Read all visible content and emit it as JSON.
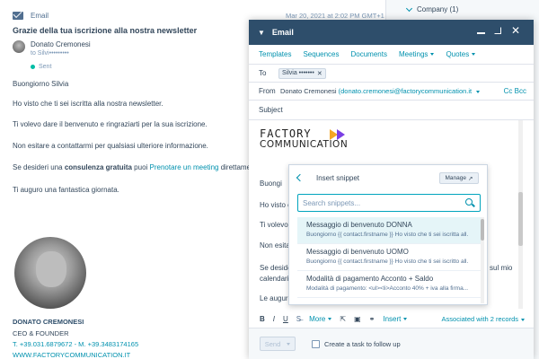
{
  "background_email": {
    "header_label": "Email",
    "date": "Mar 20, 2021 at 2:02 PM GMT+1",
    "subject": "Grazie della tua iscrizione alla nostra newsletter",
    "sender_name": "Donato Cremonesi",
    "sender_to": "to Silvi•••••••••",
    "status": "Sent",
    "greeting": "Buongiorno Silvia",
    "lines": [
      "Ho visto che ti sei iscritta alla nostra newsletter.",
      "Ti volevo dare il benvenuto e ringraziarti per la sua iscrizione.",
      "Non esitare a contattarmi per qualsiasi ulteriore informazione."
    ],
    "consult_prefix": "Se desideri una ",
    "consult_bold": "consulenza gratuita",
    "consult_mid": " puoi ",
    "consult_link": "Prenotare un meeting",
    "consult_suffix": " direttamente sul",
    "closing": "Ti auguro una fantastica giornata.",
    "signature": {
      "name": "DONATO CREMONESI",
      "role": "CEO & FOUNDER",
      "phones": "T. +39.031.6879672 - M. +39.3483174165",
      "website": "WWW.FACTORYCOMMUNICATION.IT"
    }
  },
  "sidebar": {
    "company_label": "Company (1)"
  },
  "compose": {
    "title": "Email",
    "tabs": [
      {
        "label": "Templates"
      },
      {
        "label": "Sequences"
      },
      {
        "label": "Documents"
      },
      {
        "label": "Meetings"
      },
      {
        "label": "Quotes"
      }
    ],
    "to_label": "To",
    "to_chip": "Silvia •••••••",
    "from_label": "From",
    "from_name": "Donato Cremonesi",
    "from_email": "(donato.cremonesi@factorycommunication.it",
    "cc_label": "Cc Bcc",
    "subject_label": "Subject",
    "logo_line1": "FACTORY",
    "logo_line2": "COMMUNICATION",
    "body_lines": [
      "Buongi",
      "Ho visto c",
      "Ti volevo",
      "Non esitar",
      "Se desider",
      "calendari",
      "Le auguro"
    ],
    "body_right": "sul mio",
    "toolbar": {
      "more_label": "More",
      "insert_label": "Insert",
      "associated": "Associated with 2 records"
    },
    "send_label": "Send",
    "task_label": "Create a task to follow up"
  },
  "snippet_popover": {
    "title": "Insert snippet",
    "manage_label": "Manage",
    "search_placeholder": "Search snippets...",
    "items": [
      {
        "name": "Messaggio di benvenuto DONNA",
        "preview": "Buongiorno {{ contact.firstname }} Ho visto che ti sei iscritta all..."
      },
      {
        "name": "Messaggio di benvenuto UOMO",
        "preview": "Buongiorno {{ contact.firstname }} Ho visto che ti sei iscritto all..."
      },
      {
        "name": "Modalità di pagamento Acconto + Saldo",
        "preview": "Modalità di pagamento: <ul><li>Acconto 40% + iva alla firma..."
      }
    ]
  },
  "colors": {
    "header_bg": "#2e4e6b",
    "link": "#0091ae",
    "accent_orange": "#f5a623",
    "accent_purple": "#7b3fe4"
  }
}
